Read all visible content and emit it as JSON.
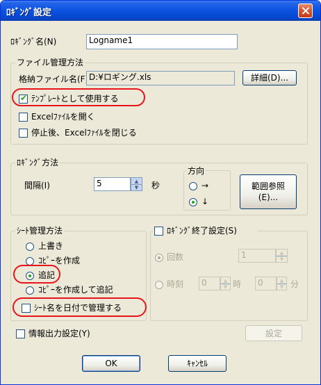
{
  "window": {
    "title": "ﾛｷﾞﾝｸﾞ設定",
    "close_icon": "close-icon"
  },
  "logging_name": {
    "label": "ﾛｷﾞﾝｸﾞ名(N)",
    "value": "Logname1"
  },
  "file_management": {
    "group_title": "ファイル管理方法",
    "storage_label": "格納ファイル名(F)",
    "storage_value": "D:¥ロギング.xls",
    "details_button": "詳細(D)...",
    "use_as_template": {
      "label": "ﾃﾝﾌﾟﾚｰﾄとして使用する",
      "checked": true
    },
    "open_excel": {
      "label": "Excelﾌｧｲﾙを開く",
      "checked": false
    },
    "close_excel_after_stop": {
      "label": "停止後、Excelﾌｧｲﾙを閉じる",
      "checked": false
    }
  },
  "logging_method": {
    "group_title": "ﾛｷﾞﾝｸﾞ方法",
    "interval_label": "間隔(I)",
    "interval_value": "5",
    "interval_unit": "秒",
    "direction": {
      "title": "方向",
      "options": [
        {
          "label": "→",
          "selected": false
        },
        {
          "label": "↓",
          "selected": true
        }
      ]
    },
    "range_button": {
      "line1": "範囲参照",
      "line2": "(E)..."
    }
  },
  "sheet_management": {
    "group_title": "ｼｰﾄ管理方法",
    "options": [
      {
        "label": "上書き",
        "selected": false
      },
      {
        "label": "ｺﾋﾟｰを作成",
        "selected": false
      },
      {
        "label": "追記",
        "selected": true
      },
      {
        "label": "ｺﾋﾟｰを作成して追記",
        "selected": false
      }
    ],
    "manage_by_date": {
      "label": "ｼｰﾄ名を日付で管理する",
      "checked": false
    }
  },
  "logging_end": {
    "checkbox_label": "ﾛｷﾞﾝｸﾞ終了設定(S)",
    "checked": false,
    "count_option": {
      "label": "回数",
      "selected": true,
      "value": "1"
    },
    "time_option": {
      "label": "時刻",
      "selected": false,
      "hour_value": "0",
      "hour_unit": "時",
      "minute_value": "0",
      "minute_unit": "分"
    }
  },
  "info_output": {
    "checkbox_label": "情報出力設定(Y)",
    "checked": false,
    "settings_button": "設定"
  },
  "footer": {
    "ok_button": "OK",
    "cancel_button": "ｷｬﾝｾﾙ"
  },
  "colors": {
    "title_bar": "#0a52e0",
    "dialog_bg": "#ece9d8",
    "highlight_ring": "#e8141c",
    "check_mark": "#21a121"
  }
}
